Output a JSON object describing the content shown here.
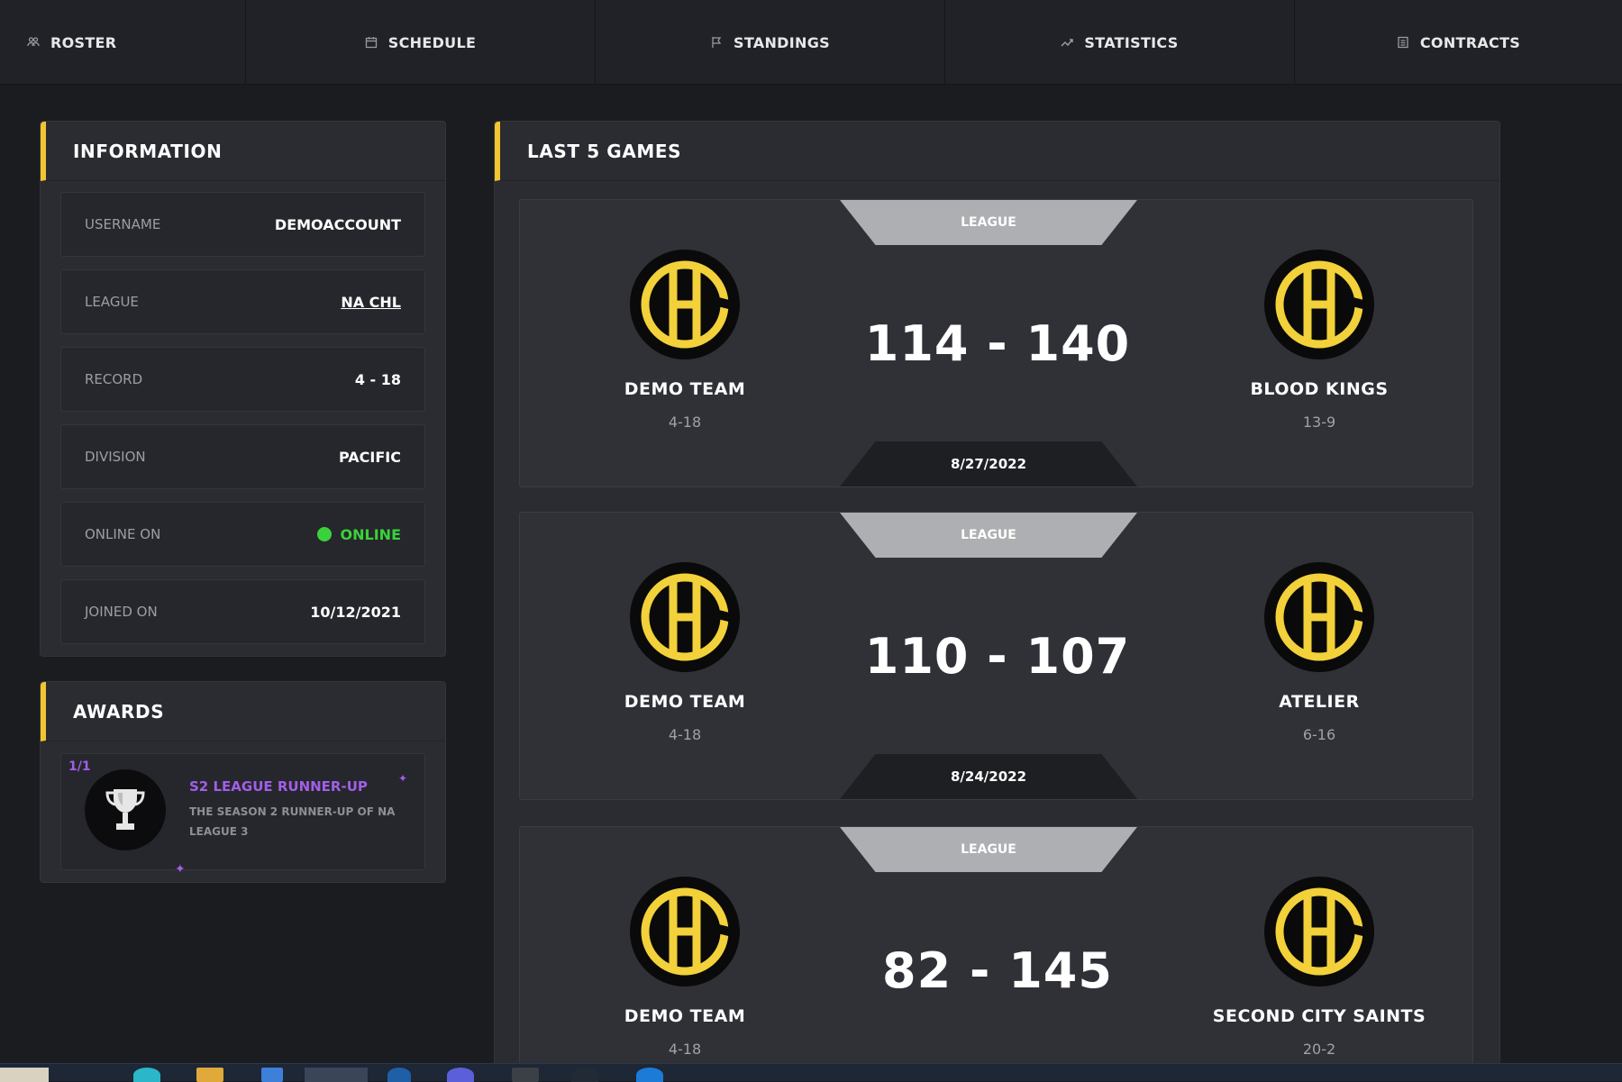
{
  "nav": [
    {
      "label": "Roster",
      "icon": "users-icon"
    },
    {
      "label": "Schedule",
      "icon": "calendar-icon"
    },
    {
      "label": "Standings",
      "icon": "flag-icon"
    },
    {
      "label": "Statistics",
      "icon": "trend-icon"
    },
    {
      "label": "Contracts",
      "icon": "document-icon"
    }
  ],
  "information": {
    "title": "Information",
    "rows": [
      {
        "label": "Username",
        "value": "DEMOACCOUNT"
      },
      {
        "label": "League",
        "value": "NA CHL"
      },
      {
        "label": "Record",
        "value": "4 - 18"
      },
      {
        "label": "Division",
        "value": "PACIFIC"
      },
      {
        "label": "Online On",
        "value": "ONLINE"
      },
      {
        "label": "Joined On",
        "value": "10/12/2021"
      }
    ]
  },
  "awards": {
    "title": "Awards",
    "items": [
      {
        "count": "1/1",
        "title": "S2 League Runner-Up",
        "description": "The season 2 runner-up of NA League 3",
        "icon": "trophy-icon"
      }
    ]
  },
  "games": {
    "title": "Last 5 Games",
    "items": [
      {
        "type": "League",
        "home": {
          "name": "Demo Team",
          "record": "4-18"
        },
        "away": {
          "name": "Blood Kings",
          "record": "13-9"
        },
        "score": "114 - 140",
        "date": "8/27/2022"
      },
      {
        "type": "League",
        "home": {
          "name": "Demo Team",
          "record": "4-18"
        },
        "away": {
          "name": "Atelier",
          "record": "6-16"
        },
        "score": "110 - 107",
        "date": "8/24/2022"
      },
      {
        "type": "League",
        "home": {
          "name": "Demo Team",
          "record": "4-18"
        },
        "away": {
          "name": "Second City Saints",
          "record": "20-2"
        },
        "score": "82 - 145",
        "date": ""
      }
    ]
  },
  "colors": {
    "accent": "#f2c531",
    "online": "#3ad23a",
    "award": "#a35ee8",
    "background": "#1b1c20",
    "panel": "#2a2c31"
  }
}
